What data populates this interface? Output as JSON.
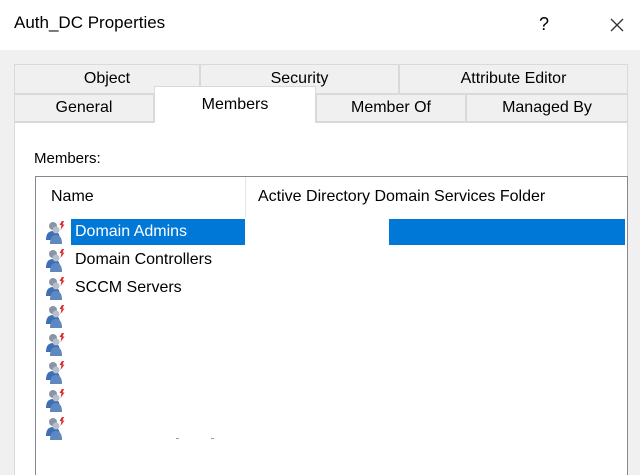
{
  "window": {
    "title": "Auth_DC Properties",
    "help_label": "?",
    "close_icon": "close-icon"
  },
  "tabs": {
    "row_back": [
      {
        "label": "Object"
      },
      {
        "label": "Security"
      },
      {
        "label": "Attribute Editor"
      }
    ],
    "row_front": [
      {
        "label": "General"
      },
      {
        "label": "Members",
        "active": true
      },
      {
        "label": "Member Of"
      },
      {
        "label": "Managed By"
      }
    ]
  },
  "members": {
    "label": "Members:",
    "columns": [
      {
        "label": "Name"
      },
      {
        "label": "Active Directory Domain Services Folder"
      }
    ],
    "rows": [
      {
        "name": "Domain Admins",
        "folder": "",
        "selected": true,
        "icon": "group-icon"
      },
      {
        "name": "Domain Controllers",
        "folder": "",
        "icon": "group-icon"
      },
      {
        "name": "SCCM Servers",
        "folder": "",
        "icon": "group-icon"
      },
      {
        "name": "",
        "folder": "",
        "icon": "group-icon"
      },
      {
        "name": "",
        "folder": "",
        "icon": "group-icon"
      },
      {
        "name": "",
        "folder": "",
        "icon": "group-icon"
      },
      {
        "name": "",
        "folder": "",
        "icon": "group-icon"
      },
      {
        "name": "",
        "folder": "",
        "icon": "group-icon"
      }
    ]
  },
  "colors": {
    "selection": "#0078d7",
    "dialog_background": "#f0f0f0",
    "icon_red": "#d9262b",
    "icon_blue": "#3d6fb4"
  }
}
